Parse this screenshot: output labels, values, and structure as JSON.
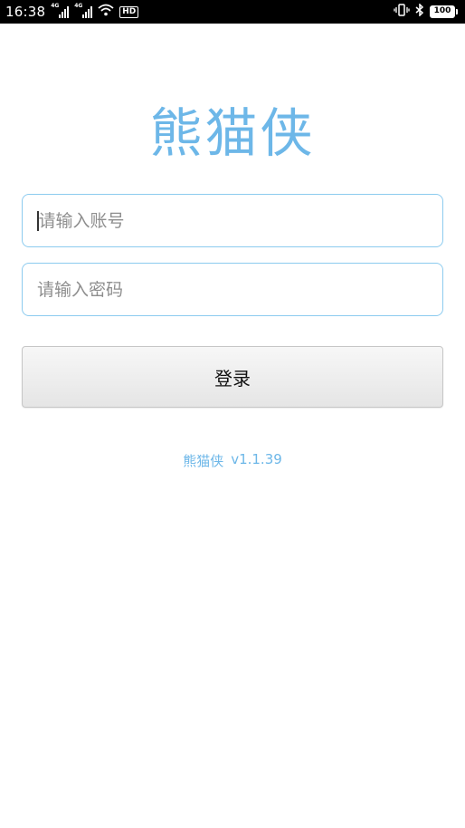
{
  "status_bar": {
    "time": "16:38",
    "network_1": "4G",
    "network_2": "4G",
    "hd_label": "HD",
    "battery_level": "100",
    "icons": [
      "signal-icon",
      "signal-icon",
      "wifi-icon",
      "hd-icon",
      "vibrate-icon",
      "bluetooth-icon",
      "battery-icon"
    ]
  },
  "login": {
    "app_title": "熊猫侠",
    "account_placeholder": "请输入账号",
    "password_placeholder": "请输入密码",
    "login_button": "登录",
    "version_name": "熊猫侠",
    "version_number": "v1.1.39"
  },
  "colors": {
    "accent": "#6db7e8",
    "input_border": "#8ccbef",
    "status_bar_bg": "#000000",
    "button_bg": "#eeeeee"
  }
}
